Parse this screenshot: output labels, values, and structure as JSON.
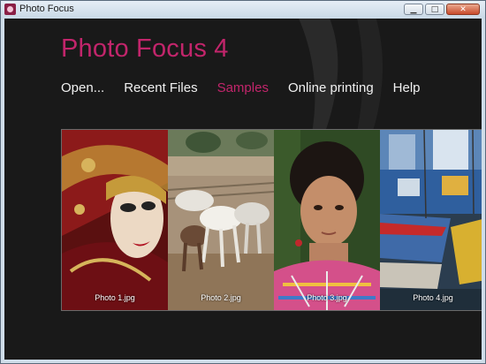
{
  "window": {
    "title": "Photo Focus"
  },
  "app": {
    "title": "Photo Focus 4"
  },
  "nav": [
    {
      "label": "Open...",
      "active": false
    },
    {
      "label": "Recent Files",
      "active": false
    },
    {
      "label": "Samples",
      "active": true
    },
    {
      "label": "Online printing",
      "active": false
    },
    {
      "label": "Help",
      "active": false
    }
  ],
  "photos": [
    {
      "caption": "Photo 1.jpg",
      "subject": "venetian-carnival-mask"
    },
    {
      "caption": "Photo 2.jpg",
      "subject": "white-horses-running"
    },
    {
      "caption": "Photo 3.jpg",
      "subject": "girl-portrait"
    },
    {
      "caption": "Photo 4.jpg",
      "subject": "fishing-boats-harbor"
    }
  ],
  "colors": {
    "accent": "#c2256b",
    "background": "#191919",
    "nav_text": "#f0f0f0"
  }
}
